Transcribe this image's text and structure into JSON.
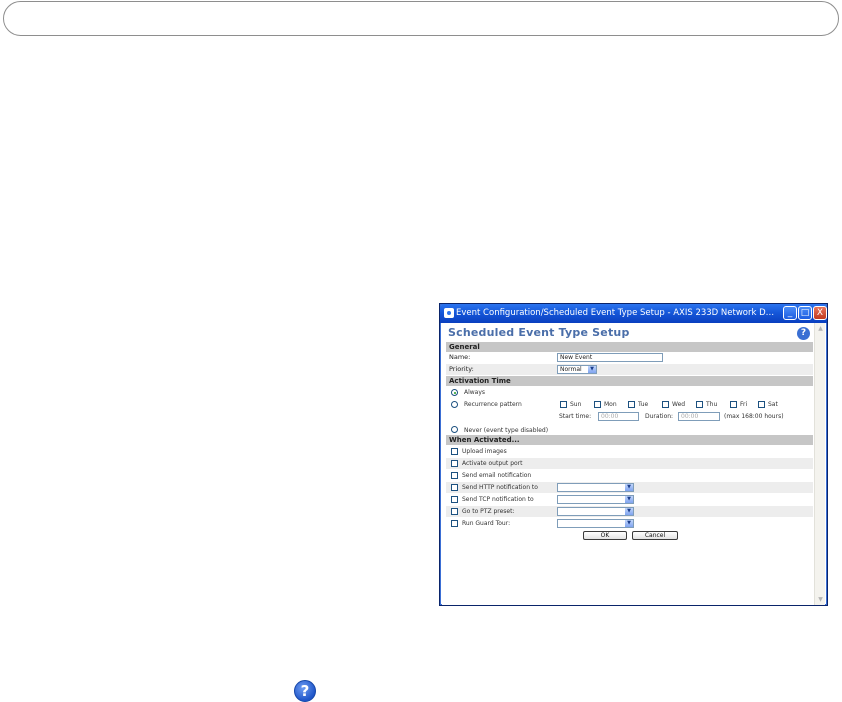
{
  "window": {
    "title": "Event Configuration/Scheduled Event Type Setup - AXIS 233D Network Dome Cam...",
    "minimize": "_",
    "maximize": "□",
    "close": "X"
  },
  "page": {
    "heading": "Scheduled Event Type Setup",
    "help": "?"
  },
  "general": {
    "section": "General",
    "name_label": "Name:",
    "name_value": "New Event",
    "priority_label": "Priority:",
    "priority_value": "Normal"
  },
  "activation": {
    "section": "Activation Time",
    "always": "Always",
    "recurrence": "Recurrence pattern",
    "days": [
      "Sun",
      "Mon",
      "Tue",
      "Wed",
      "Thu",
      "Fri",
      "Sat"
    ],
    "start_label": "Start time:",
    "start_value": "00:00",
    "duration_label": "Duration:",
    "duration_value": "00:00",
    "max_note": "(max 168:00 hours)",
    "never": "Never (event type disabled)"
  },
  "when": {
    "section": "When Activated...",
    "upload": "Upload images",
    "output": "Activate output port",
    "email": "Send email notification",
    "http": "Send HTTP notification to",
    "tcp": "Send TCP notification to",
    "ptz": "Go to PTZ preset:",
    "guard": "Run Guard Tour:"
  },
  "buttons": {
    "ok": "OK",
    "cancel": "Cancel"
  },
  "footer": {
    "help": "?"
  }
}
